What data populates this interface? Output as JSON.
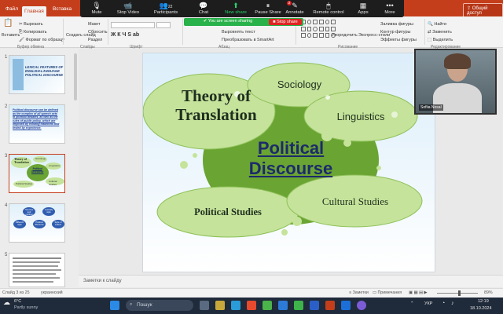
{
  "ribbon": {
    "tabs": [
      "Файл",
      "Главная",
      "Вставка"
    ],
    "share": "Общий доступ",
    "items": {
      "paste": "Вставить",
      "cut": "Вырезать",
      "copy": "Копировать",
      "format": "Формат по образцу",
      "create": "Создать слайд",
      "layout": "Макет",
      "reset": "Сбросить",
      "section": "Раздел",
      "textdir": "Направление текста",
      "align": "Выровнять текст",
      "convert": "Преобразовать в SmartArt",
      "arrange": "Упорядочить",
      "styles": "Экспресс-стили",
      "fill": "Заливка фигуры",
      "outline": "Контур фигуры",
      "effects": "Эффекты фигуры",
      "find": "Найти",
      "replace": "Заменить",
      "select": "Выделить"
    },
    "groups": [
      "Буфер обмена",
      "Слайды",
      "Шрифт",
      "Абзац",
      "Рисование",
      "Редактирование"
    ]
  },
  "zoom": {
    "buttons": [
      {
        "label": "Mute",
        "icon": "mic-icon"
      },
      {
        "label": "Stop Video",
        "icon": "video-icon"
      },
      {
        "label": "Participants",
        "icon": "participants-icon"
      },
      {
        "label": "Chat",
        "icon": "chat-icon"
      },
      {
        "label": "New share",
        "icon": "share-icon"
      },
      {
        "label": "Pause Share",
        "icon": "pause-icon"
      },
      {
        "label": "Annotate",
        "icon": "annotate-icon"
      },
      {
        "label": "Remote control",
        "icon": "remote-icon"
      },
      {
        "label": "Apps",
        "icon": "apps-icon"
      },
      {
        "label": "More",
        "icon": "more-icon"
      }
    ],
    "participants_count": "22",
    "chat_badge": "2",
    "sharing_text": "You are screen sharing",
    "stop_share": "Stop share"
  },
  "thumbs": [
    {
      "num": "1",
      "lines": [
        "LEXICAL FEATURES OF",
        "ENGLISH-LANGUAGE",
        "POLITICAL DISCOURSE"
      ]
    },
    {
      "num": "2",
      "lines": [
        "Political discourse can be defined",
        "as the complex of all speech acts",
        "in political debates, as well as the",
        "rules of public policy, which are",
        "imposed by existing traditions and",
        "tested by experience."
      ]
    },
    {
      "num": "3",
      "lines": [
        "Theory of",
        "Translation",
        "Sociology",
        "Linguistics",
        "Political",
        "Discourse",
        "Political Studies",
        "Cultural Studies"
      ]
    },
    {
      "num": "4",
      "lines": [
        "Sources and",
        "political texts",
        "Lexically",
        "style",
        "Different",
        "style",
        "Political",
        "discourse",
        "Style of",
        "Letters"
      ]
    },
    {
      "num": "5",
      "lines": []
    }
  ],
  "slide": {
    "theory": "Theory of Translation",
    "sociology": "Sociology",
    "linguistics": "Linguistics",
    "political": "Political",
    "discourse": "Discourse",
    "political_studies": "Political Studies",
    "cultural_studies": "Cultural Studies"
  },
  "notes": "Заметки к слайду",
  "status": {
    "slide": "Слайд 3 из 25",
    "lang": "украинский",
    "notes": "Заметки",
    "comments": "Примечания",
    "zoom": "89%"
  },
  "video": {
    "name": "Sofiia Nosal"
  },
  "taskbar": {
    "temp": "6°C",
    "weather": "Partly sunny",
    "search": "Пошук",
    "lang": "УКР",
    "time": "12:19",
    "date": "18.10.2024"
  },
  "colors": {
    "accent": "#c43e1c",
    "green_dark": "#6aa433",
    "green_light": "#c5e39a",
    "zoom_green": "#29b14a"
  }
}
